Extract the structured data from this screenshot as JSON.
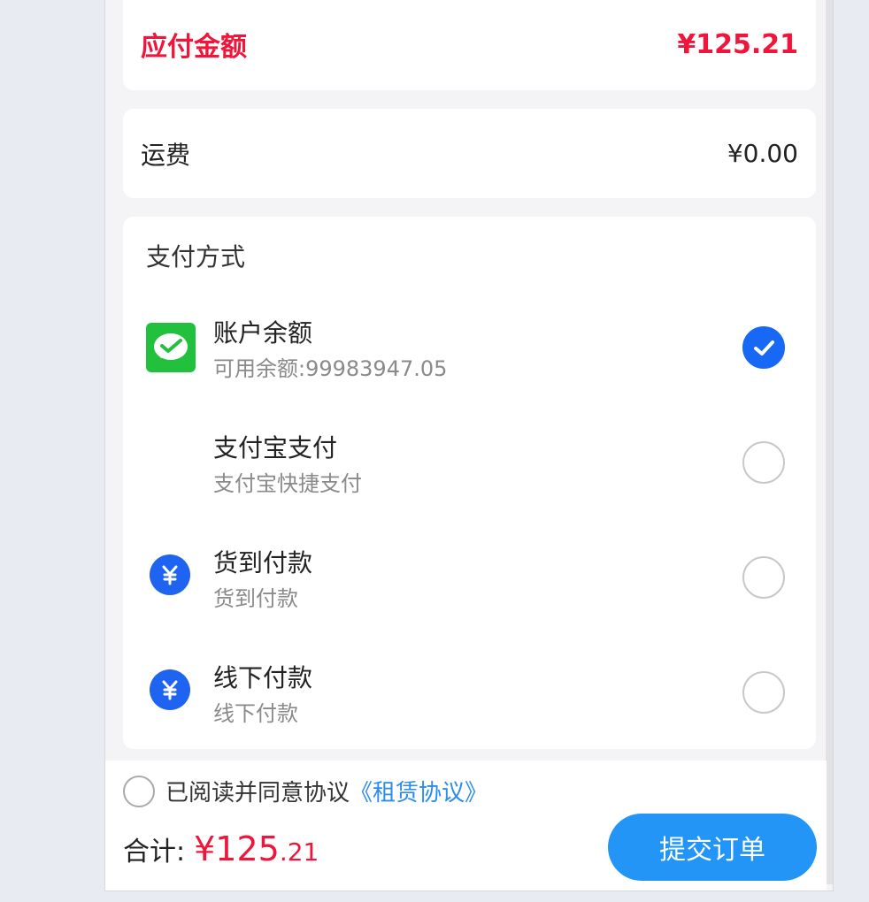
{
  "summary": {
    "payable_label": "应付金额",
    "payable_amount": "¥125.21"
  },
  "shipping": {
    "label": "运费",
    "amount": "¥0.00"
  },
  "payment": {
    "title": "支付方式",
    "methods": [
      {
        "name": "账户余额",
        "sub": "可用余额:99983947.05",
        "icon": "wechat-icon",
        "checked": true
      },
      {
        "name": "支付宝支付",
        "sub": "支付宝快捷支付",
        "icon": "",
        "checked": false
      },
      {
        "name": "货到付款",
        "sub": "货到付款",
        "icon": "yuan-icon",
        "checked": false
      },
      {
        "name": "线下付款",
        "sub": "线下付款",
        "icon": "yuan-icon",
        "checked": false
      }
    ]
  },
  "footer": {
    "agree_text": "已阅读并同意协议",
    "agreement_link": "《租赁协议》",
    "total_label": "合计:",
    "total_currency": "¥",
    "total_int": "125",
    "total_dec": ".21",
    "submit_label": "提交订单"
  },
  "colors": {
    "accent_red": "#f0153a",
    "primary_blue": "#1768f5",
    "button_blue": "#2295f7",
    "link_blue": "#2b8cf0",
    "wechat_green": "#22c13d"
  }
}
